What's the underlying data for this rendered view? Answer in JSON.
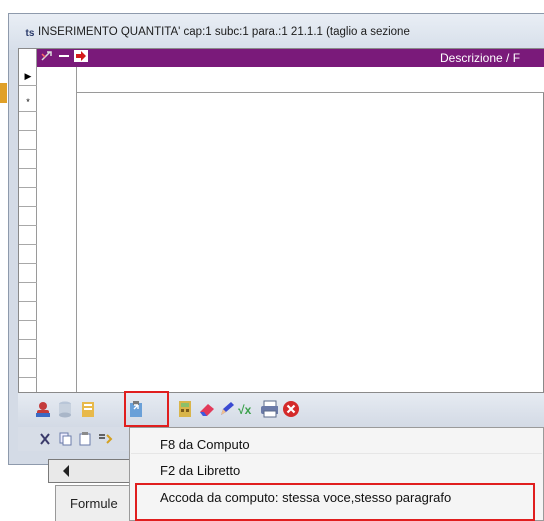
{
  "window": {
    "title": "INSERIMENTO QUANTITA' cap:1 subc:1 para.:1    21.1.1  (taglio a sezione"
  },
  "grid": {
    "header_label": "Descrizione / F",
    "row_markers": [
      "▶",
      "*"
    ]
  },
  "toolbar": {
    "icons": [
      "user-red-icon",
      "database-icon",
      "book-icon",
      "paste-dropdown-icon",
      "calculator-icon",
      "eraser-icon",
      "pencil-icon",
      "formula-icon",
      "print-icon",
      "close-red-icon"
    ]
  },
  "toolbar2": {
    "icons": [
      "cut-icon",
      "copy-icon",
      "paste-icon",
      "move-icon"
    ]
  },
  "menu": {
    "items": [
      {
        "label": "F8 da Computo"
      },
      {
        "label": "F2 da Libretto"
      },
      {
        "label": "Accoda da computo: stessa voce,stesso paragrafo"
      }
    ]
  },
  "tabs": {
    "formule": "Formule"
  },
  "colors": {
    "header": "#7a1a7a",
    "highlight": "#e01e1e"
  }
}
